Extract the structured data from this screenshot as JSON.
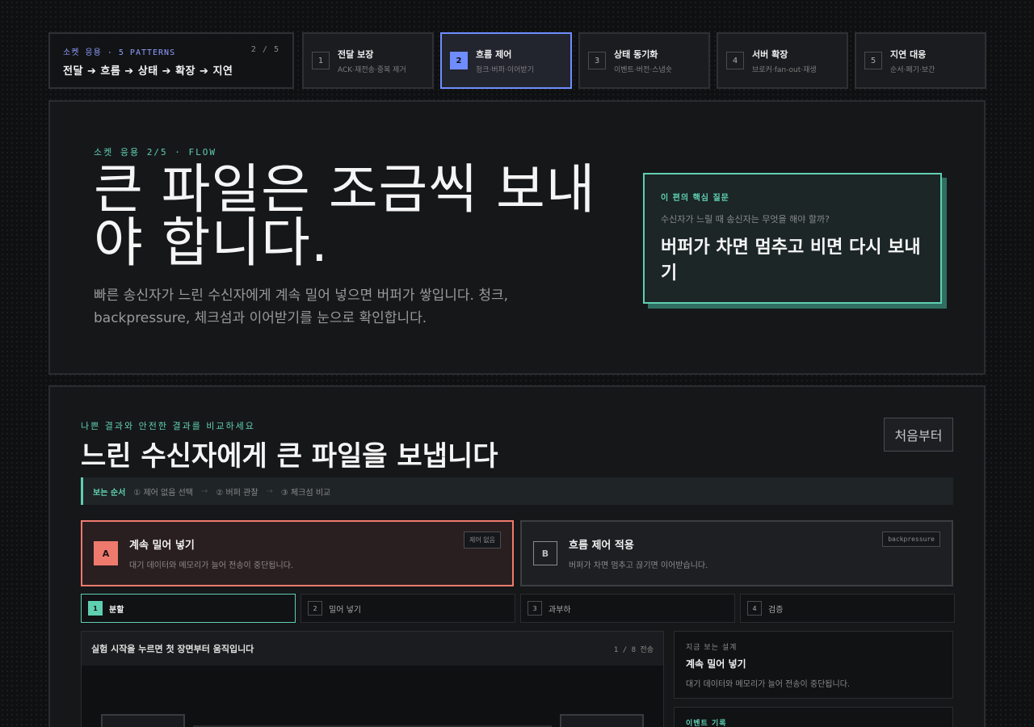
{
  "series": {
    "eyebrow": "소켓 응용 · 5 PATTERNS",
    "count": "2 / 5",
    "path": "전달 ➔ 흐름 ➔ 상태 ➔ 확장 ➔ 지연"
  },
  "steps": [
    {
      "num": "1",
      "title": "전달 보장",
      "sub": "ACK·재전송·중복 제거"
    },
    {
      "num": "2",
      "title": "흐름 제어",
      "sub": "청크·버퍼·이어받기"
    },
    {
      "num": "3",
      "title": "상태 동기화",
      "sub": "이벤트·버전·스냅숏"
    },
    {
      "num": "4",
      "title": "서버 확장",
      "sub": "브로커·fan-out·재생"
    },
    {
      "num": "5",
      "title": "지연 대응",
      "sub": "순서·폐기·보간"
    }
  ],
  "hero": {
    "eyebrow": "소켓 응용 2/5 · FLOW",
    "title": "큰 파일은 조금씩 보내야 합니다.",
    "desc": "빠른 송신자가 느린 수신자에게 계속 밀어 넣으면 버퍼가 쌓입니다. 청크, backpressure, 체크섬과 이어받기를 눈으로 확인합니다.",
    "question_label": "이 편의 핵심 질문",
    "question": "수신자가 느릴 때 송신자는 무엇을 해야 할까?",
    "answer": "버퍼가 차면 멈추고 비면 다시 보내기"
  },
  "lab": {
    "eyebrow": "나쁜 결과와 안전한 결과를 비교하세요",
    "title": "느린 수신자에게 큰 파일을 보냅니다",
    "reset": "처음부터",
    "order_label": "보는 순서",
    "order_steps": [
      "① 제어 없음 선택",
      "② 버퍼 관찰",
      "③ 체크섬 비교"
    ],
    "options": [
      {
        "badge": "A",
        "title": "계속 밀어 넣기",
        "sub": "대기 데이터와 메모리가 늘어 전송이 중단됩니다.",
        "tag": "제어 없음"
      },
      {
        "badge": "B",
        "title": "흐름 제어 적용",
        "sub": "버퍼가 차면 멈추고 끊기면 이어받습니다.",
        "tag": "backpressure"
      }
    ],
    "phases": [
      {
        "num": "1",
        "label": "분할"
      },
      {
        "num": "2",
        "label": "밀어 넣기"
      },
      {
        "num": "3",
        "label": "과부하"
      },
      {
        "num": "4",
        "label": "검증"
      }
    ],
    "sim_title": "실험 시작을 누르면 첫 장면부터 움직입니다",
    "sim_count": "1 / 8 전송",
    "design_label": "지금 보는 설계",
    "design_title": "계속 밀어 넣기",
    "design_sub": "대기 데이터와 메모리가 늘어 전송이 중단됩니다.",
    "log_label": "이벤트 기록"
  },
  "colors": {
    "accent": "#5fcfb2",
    "active_step": "#6f8dff",
    "danger": "#ee7a6e"
  }
}
